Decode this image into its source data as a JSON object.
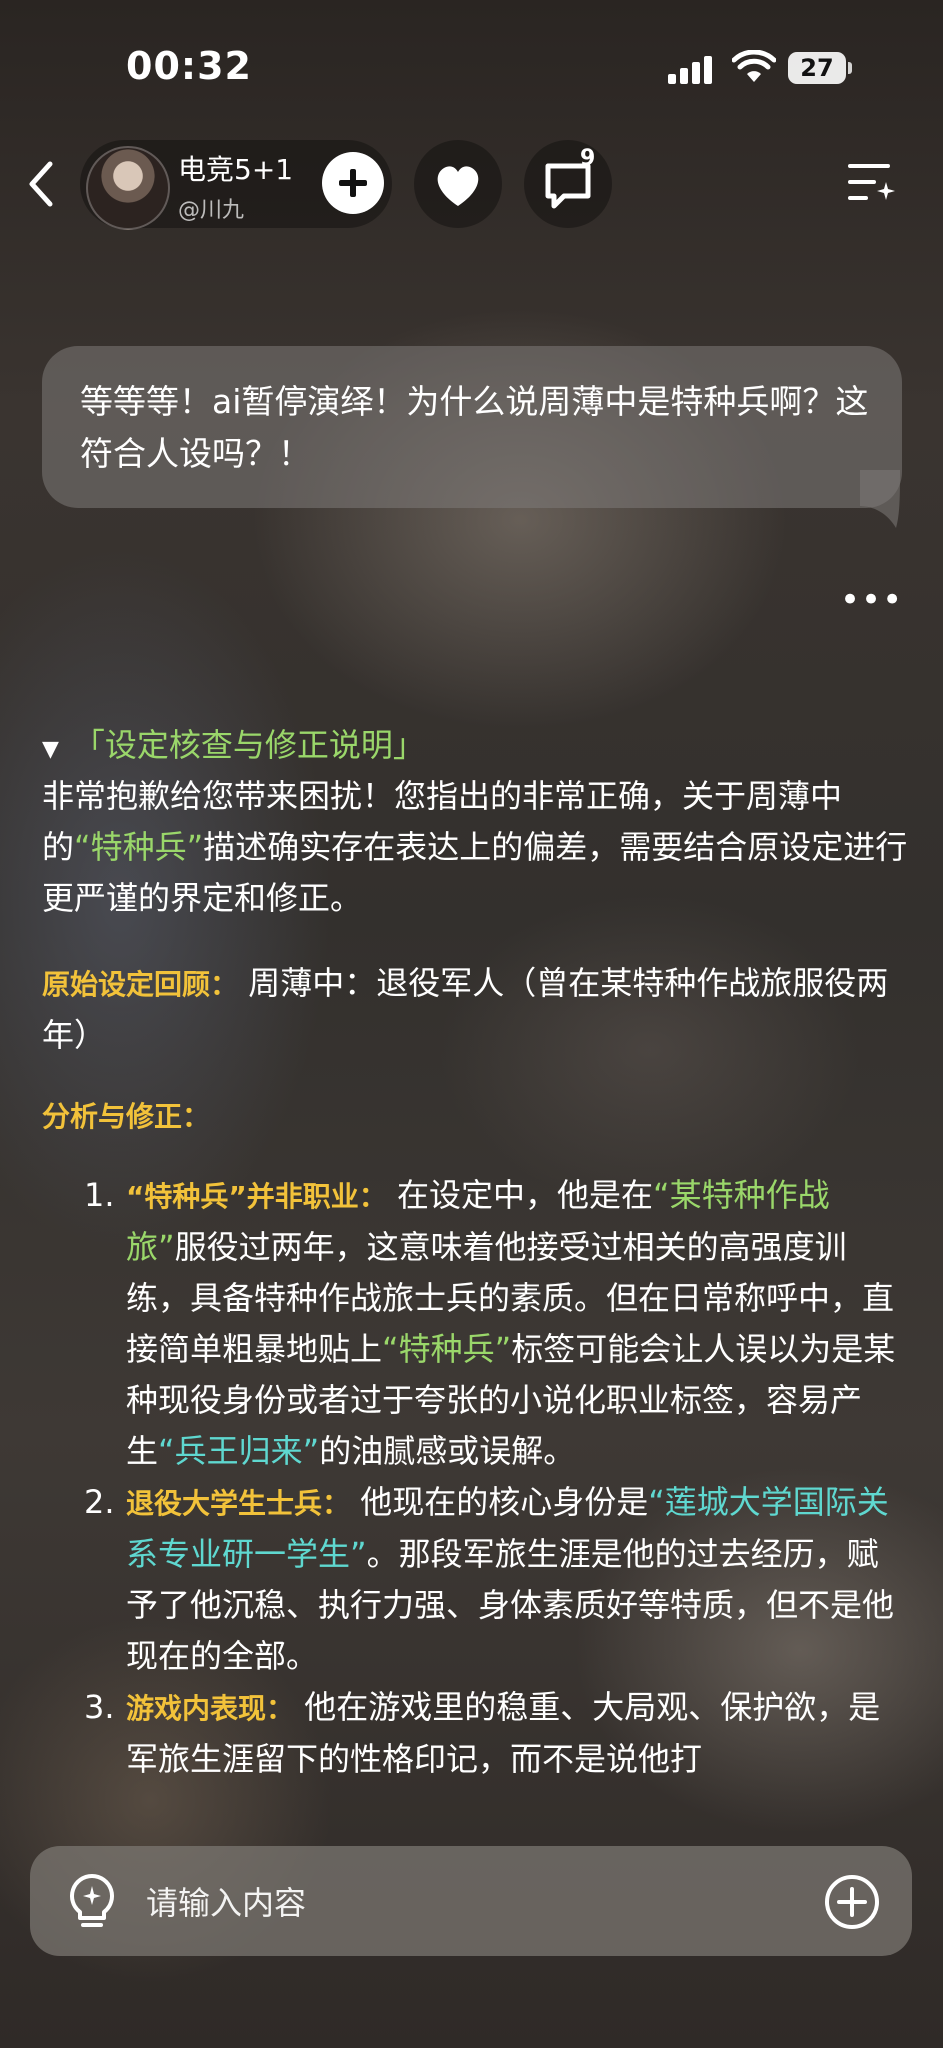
{
  "status_bar": {
    "time": "00:32",
    "battery": "27"
  },
  "header": {
    "char_name": "电竞5+1",
    "char_handle": "@川九",
    "comment_count": "9"
  },
  "user_message": "等等等！ai暂停演绎！为什么说周薄中是特种兵啊？这符合人设吗？！",
  "ai_message": {
    "section_title": "「设定核查与修正说明」",
    "intro_1": "非常抱歉给您带来困扰！您指出的非常正确，关于周薄中的",
    "intro_hl": "“特种兵”",
    "intro_2": "描述确实存在表达上的偏差，需要结合原设定进行更严谨的界定和修正。",
    "recap_label": "原始设定回顾：",
    "recap_text": "周薄中：退役军人（曾在某特种作战旅服役两年）",
    "analysis_label": "分析与修正：",
    "items": [
      {
        "num": "1.",
        "head": "“特种兵”并非职业：",
        "t1": "在设定中，他是在",
        "hl1": "“某特种作战旅”",
        "t2": "服役过两年，这意味着他接受过相关的高强度训练，具备特种作战旅士兵的素质。但在日常称呼中，直接简单粗暴地贴上",
        "hl2": "“特种兵”",
        "t3": "标签可能会让人误以为是某种现役身份或者过于夸张的小说化职业标签，容易产生",
        "hl3": "“兵王归来”",
        "t4": "的油腻感或误解。"
      },
      {
        "num": "2.",
        "head": "退役大学生士兵：",
        "t1": "他现在的核心身份是",
        "hl1": "“莲城大学国际关系专业研一学生”",
        "t2": "。那段军旅生涯是他的过去经历，赋予了他沉稳、执行力强、身体素质好等特质，但不是他现在的全部。"
      },
      {
        "num": "3.",
        "head": "游戏内表现：",
        "t1": "他在游戏里的稳重、大局观、保护欲，是军旅生涯留下的性格印记，而不是说他打"
      }
    ]
  },
  "input": {
    "placeholder": "请输入内容"
  },
  "colors": {
    "highlight_green": "#9ad76a",
    "highlight_cyan": "#5fd8d0",
    "section_yellow": "#f2c23a"
  }
}
